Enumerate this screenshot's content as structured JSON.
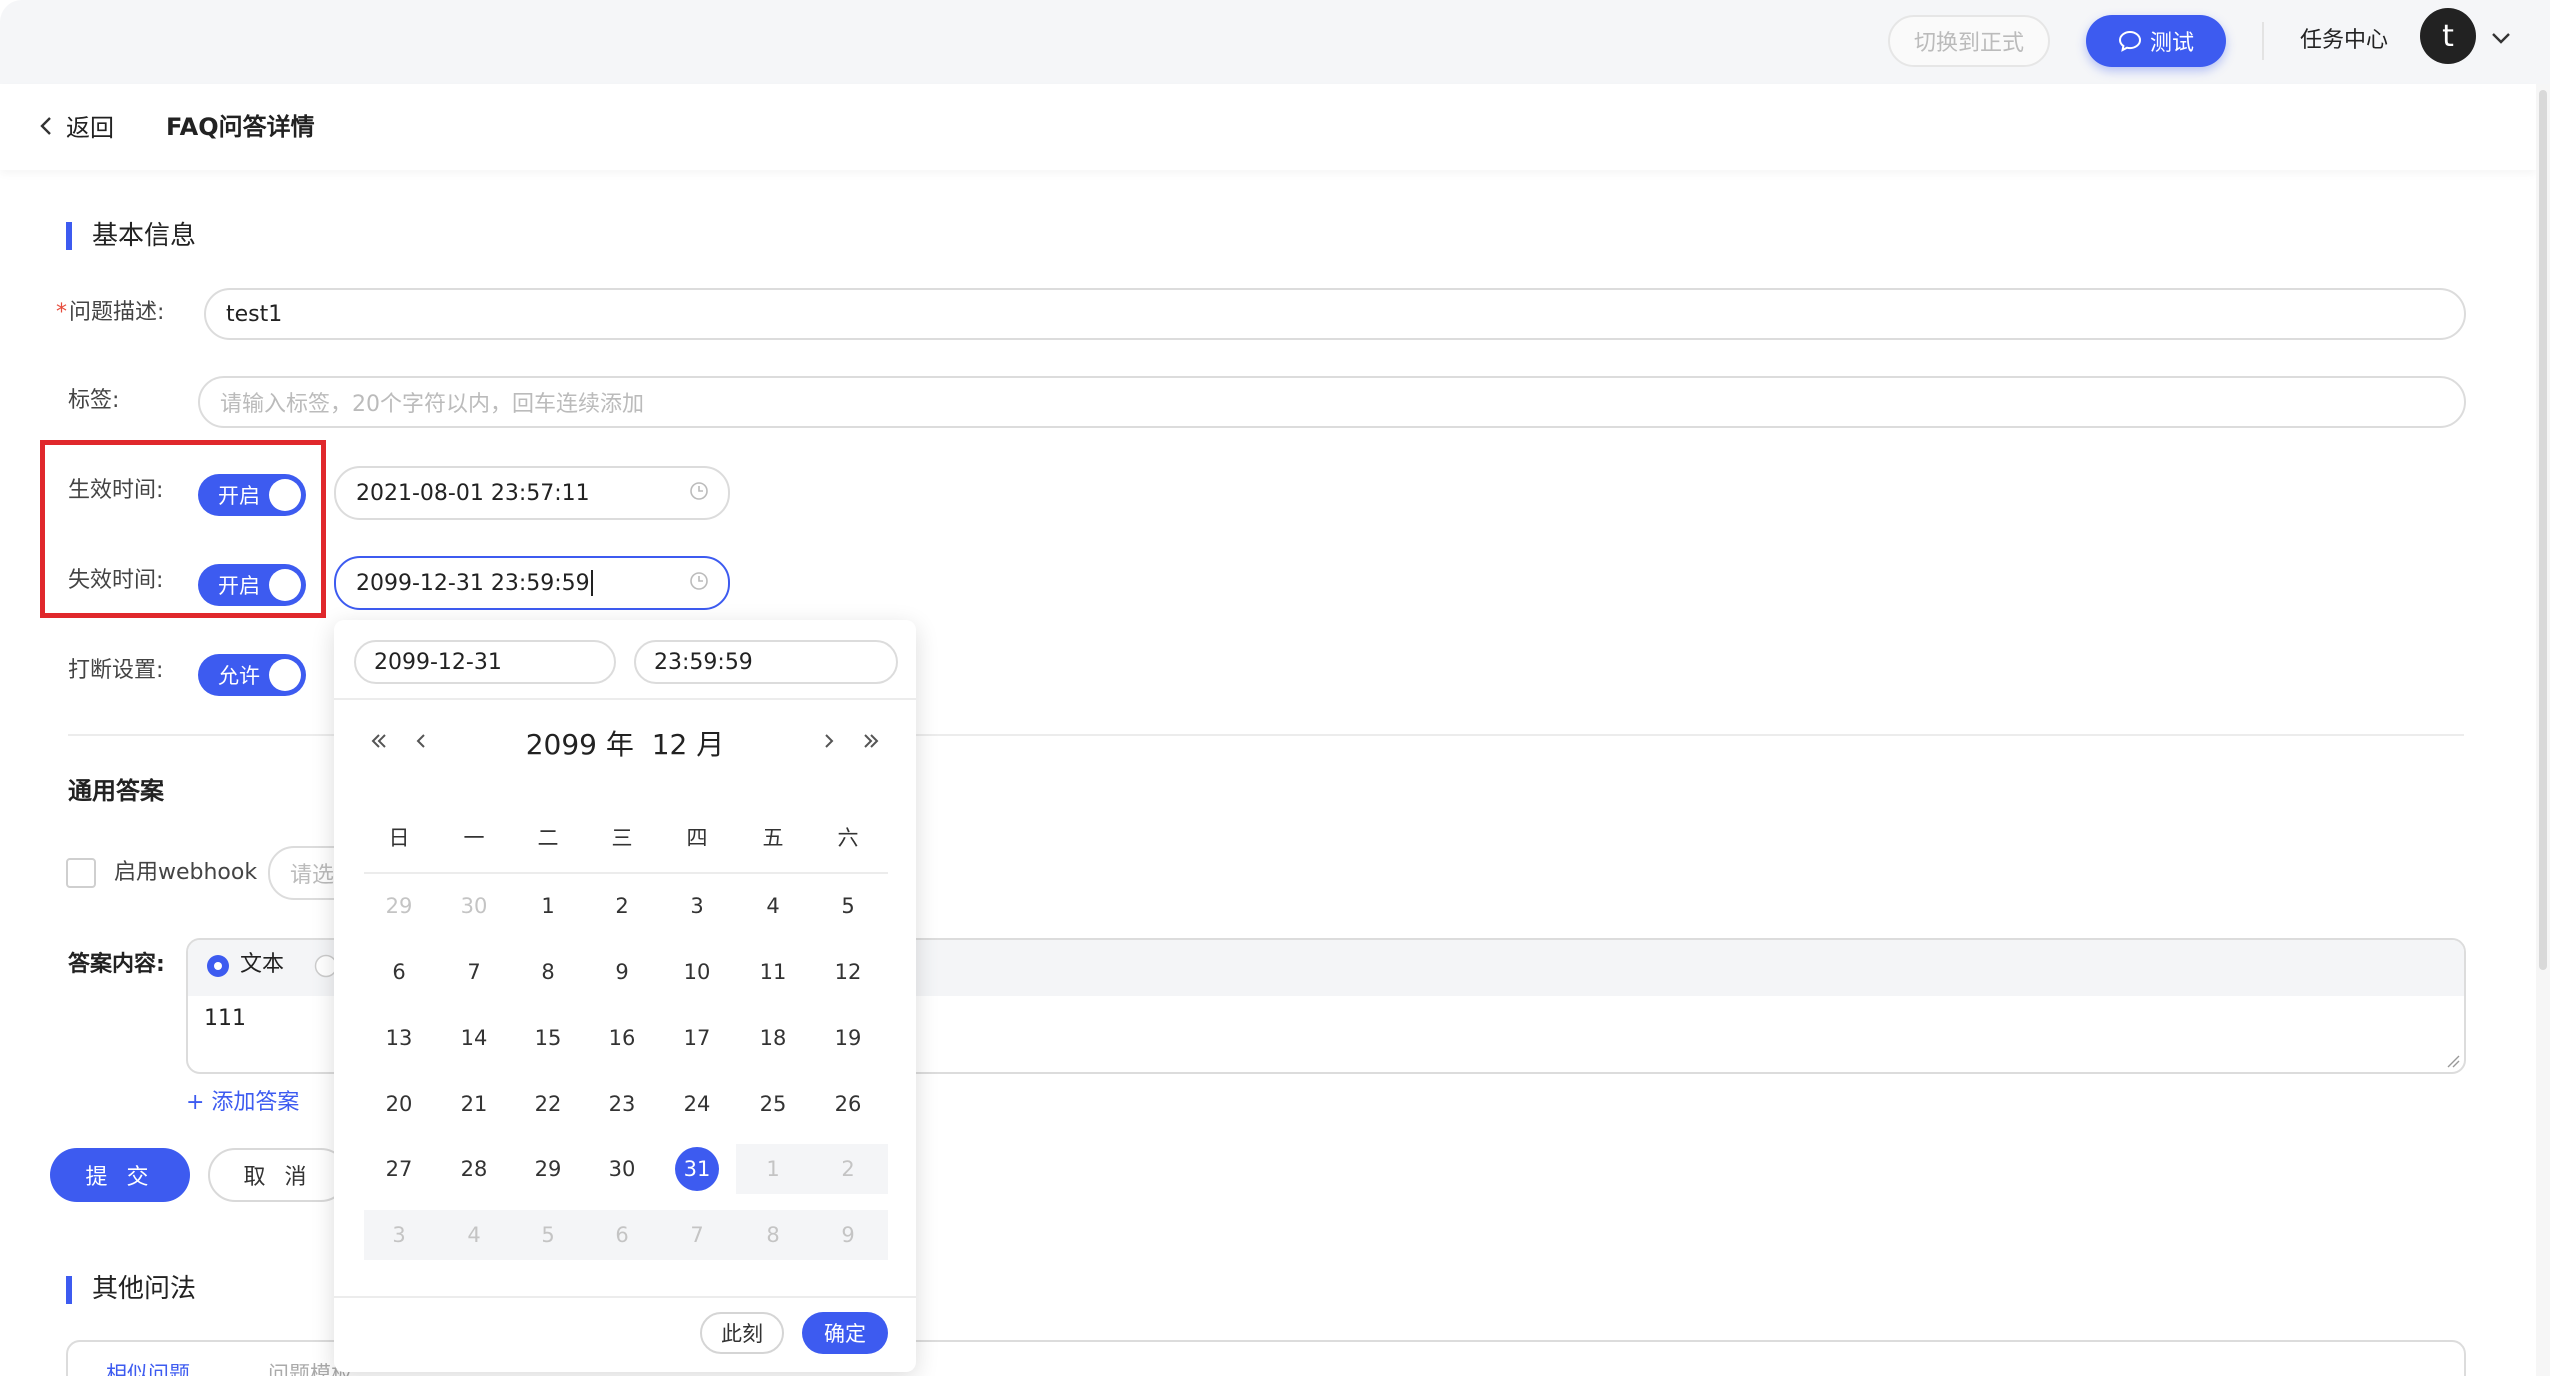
{
  "topbar": {
    "switch_label": "切换到正式",
    "test_label": "测试",
    "task_center": "任务中心",
    "avatar_letter": "t"
  },
  "header": {
    "back_label": "返回",
    "title": "FAQ问答详情"
  },
  "basic": {
    "section_title": "基本信息",
    "question_label": "问题描述:",
    "question_required_mark": "*",
    "question_value": "test1",
    "tags_label": "标签:",
    "tags_placeholder": "请输入标签，20个字符以内，回车连续添加",
    "effective_label": "生效时间:",
    "effective_toggle": "开启",
    "effective_value": "2021-08-01 23:57:11",
    "expire_label": "失效时间:",
    "expire_toggle": "开启",
    "expire_value": "2099-12-31 23:59:59",
    "interrupt_label": "打断设置:",
    "interrupt_toggle": "允许"
  },
  "general": {
    "section_title": "通用答案",
    "webhook_label": "启用webhook",
    "webhook_placeholder": "请选",
    "answer_label": "答案内容:",
    "text_radio": "文本",
    "answer_value": "111",
    "add_answer": "+ 添加答案",
    "submit": "提 交",
    "cancel": "取 消"
  },
  "other": {
    "section_title": "其他问法",
    "tab1": "相似问题",
    "tab2": "问题模板"
  },
  "picker": {
    "date_value": "2099-12-31",
    "time_value": "23:59:59",
    "year_label": "2099 年",
    "month_label": "12 月",
    "weekdays": [
      "日",
      "一",
      "二",
      "三",
      "四",
      "五",
      "六"
    ],
    "weeks": [
      [
        "29",
        "30",
        "1",
        "2",
        "3",
        "4",
        "5"
      ],
      [
        "6",
        "7",
        "8",
        "9",
        "10",
        "11",
        "12"
      ],
      [
        "13",
        "14",
        "15",
        "16",
        "17",
        "18",
        "19"
      ],
      [
        "20",
        "21",
        "22",
        "23",
        "24",
        "25",
        "26"
      ],
      [
        "27",
        "28",
        "29",
        "30",
        "31",
        "1",
        "2"
      ],
      [
        "3",
        "4",
        "5",
        "6",
        "7",
        "8",
        "9"
      ]
    ],
    "selected_day": "31",
    "now_label": "此刻",
    "ok_label": "确定"
  },
  "colors": {
    "primary": "#3d5bf0",
    "highlight": "#e0282c"
  }
}
